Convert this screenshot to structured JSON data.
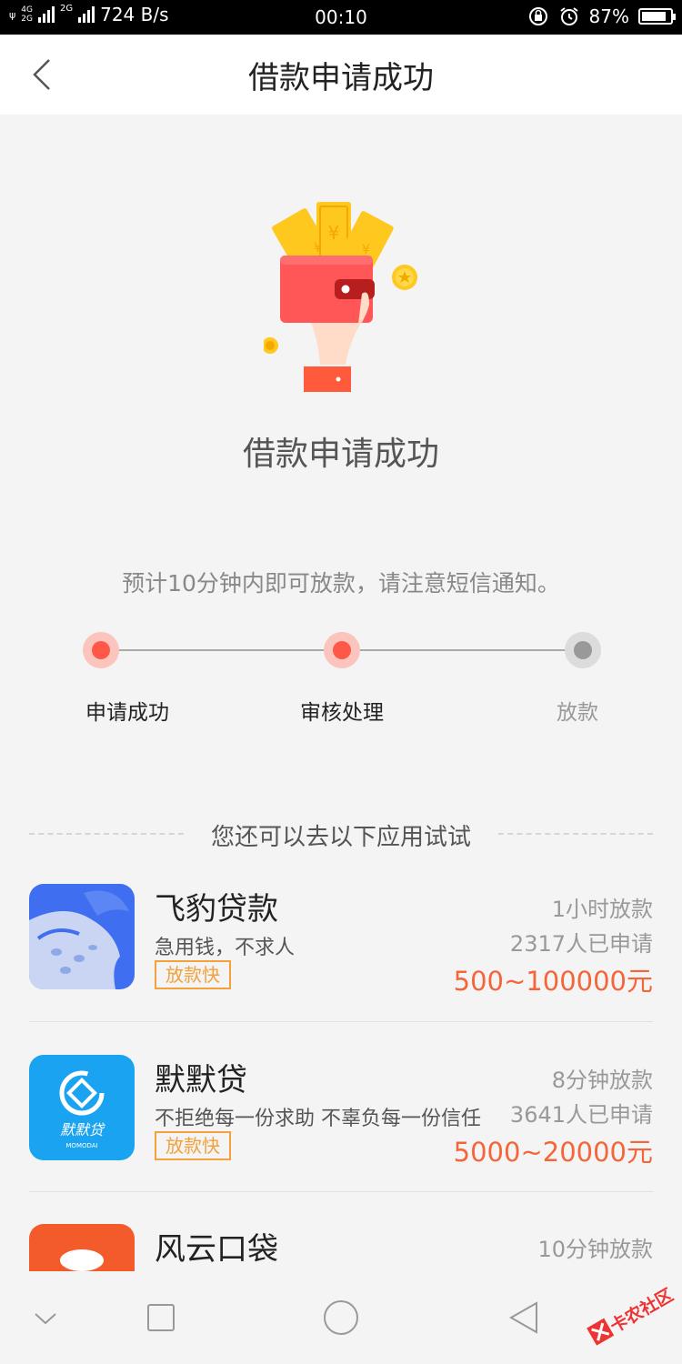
{
  "status_bar": {
    "network_top": "4G",
    "network_bottom": "2G",
    "network2": "2G",
    "speed": "724 B/s",
    "time": "00:10",
    "battery": "87%",
    "battery_level": 0.87
  },
  "header": {
    "title": "借款申请成功"
  },
  "result": {
    "title": "借款申请成功",
    "notice": "预计10分钟内即可放款，请注意短信通知。"
  },
  "steps": [
    {
      "label": "申请成功",
      "state": "active"
    },
    {
      "label": "审核处理",
      "state": "active"
    },
    {
      "label": "放款",
      "state": "inactive"
    }
  ],
  "recommend": {
    "title": "您还可以去以下应用试试",
    "apps": [
      {
        "name": "飞豹贷款",
        "desc": "急用钱，不求人",
        "tag": "放款快",
        "speed": "1小时放款",
        "applicants": "2317人已申请",
        "amount": "500~100000元",
        "logo_color": "#3f6ff0",
        "logo_icon": "leopard-logo-icon"
      },
      {
        "name": "默默贷",
        "desc": "不拒绝每一份求助 不辜负每一份信任",
        "tag": "放款快",
        "speed": "8分钟放款",
        "applicants": "3641人已申请",
        "amount": "5000~20000元",
        "logo_color": "#1aa3f0",
        "logo_icon": "momodai-logo-icon",
        "logo_text": "默默贷",
        "logo_subtext": "MOMODAI"
      },
      {
        "name": "风云口袋",
        "desc": "",
        "tag": "",
        "speed": "10分钟放款",
        "applicants": "",
        "amount": "",
        "logo_color": "#f45b2a",
        "logo_icon": "money-bag-logo-icon"
      }
    ]
  },
  "watermark": {
    "text": "卡农社区"
  },
  "colors": {
    "accent": "#ff5848",
    "amount": "#f4663a",
    "tag": "#f4a03b"
  }
}
